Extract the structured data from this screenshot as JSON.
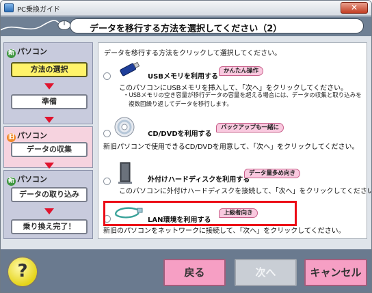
{
  "window": {
    "title": "PC乗換ガイド",
    "close_label": "✕"
  },
  "header": {
    "title": "データを移行する方法を選択してください（2）"
  },
  "sidebar": {
    "new_pc_badge": "新",
    "new_pc_label": "パソコン",
    "old_pc_badge": "旧",
    "old_pc_label": "パソコン",
    "new_pc2_badge": "新",
    "new_pc2_label": "パソコン",
    "steps": [
      "方法の選択",
      "準備",
      "データの収集",
      "データの取り込み",
      "乗り換え完了！"
    ]
  },
  "main": {
    "instruction": "データを移行する方法をクリックして選択してください。",
    "options": [
      {
        "title": "USBメモリを利用する",
        "tag": "かんたん操作",
        "desc": "このパソコンにUSBメモリを挿入して、「次へ」をクリックしてください。",
        "note1": "・USBメモリの空き容量が移行データの容量を超える場合には、データの収集と取り込みを",
        "note2": "複数回繰り返してデータを移行します。"
      },
      {
        "title": "CD/DVDを利用する",
        "tag": "バックアップも一緒に",
        "desc": "新旧パソコンで使用できるCD/DVDを用意して、「次へ」をクリックしてください。"
      },
      {
        "title": "外付けハードディスクを利用する",
        "tag": "データ量多め向き",
        "desc": "このパソコンに外付けハードディスクを接続して、「次へ」をクリックしてください。"
      },
      {
        "title": "LAN環境を利用する",
        "tag": "上級者向き",
        "desc": "新旧のパソコンをネットワークに接続して、「次へ」をクリックしてください。"
      }
    ]
  },
  "footer": {
    "help_label": "?",
    "back_label": "戻る",
    "next_label": "次へ",
    "cancel_label": "キャンセル"
  },
  "colors": {
    "accent_red": "#ec0b16",
    "active_step": "#fff36a",
    "pink_button": "#f69fc4",
    "banner": "#6f8094"
  }
}
